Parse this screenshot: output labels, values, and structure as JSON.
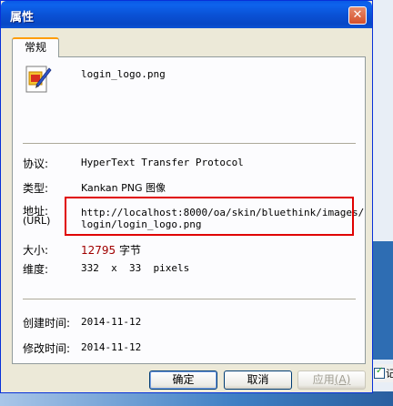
{
  "window": {
    "title": "属性",
    "close_glyph": "✕"
  },
  "tabs": [
    {
      "label": "常规",
      "active": true
    }
  ],
  "file": {
    "name": "login_logo.png",
    "icon": "png-image-file-icon"
  },
  "properties": {
    "protocol": {
      "label": "协议:",
      "value": "HyperText Transfer Protocol"
    },
    "type": {
      "label": "类型:",
      "value": "Kankan PNG 图像"
    },
    "address": {
      "label": "地址:",
      "label_sub": "(URL)",
      "value_line1": "http://localhost:8000/oa/skin/bluethink/images/",
      "value_line2": "login/login_logo.png"
    },
    "size": {
      "label": "大小:",
      "number": "12795",
      "unit": " 字节"
    },
    "dimensions": {
      "label": "维度:",
      "value": "332  x  33  pixels"
    },
    "created": {
      "label": "创建时间:",
      "value": "2014-11-12"
    },
    "modified": {
      "label": "修改时间:",
      "value": "2014-11-12"
    }
  },
  "buttons": {
    "ok": "确定",
    "cancel": "取消",
    "apply": "应用",
    "apply_accel": "(A)"
  },
  "background": {
    "checkbox_text": "记"
  },
  "colors": {
    "title_bar": "#0a52d6",
    "highlight_border": "#e00000",
    "size_number": "#a00000"
  }
}
